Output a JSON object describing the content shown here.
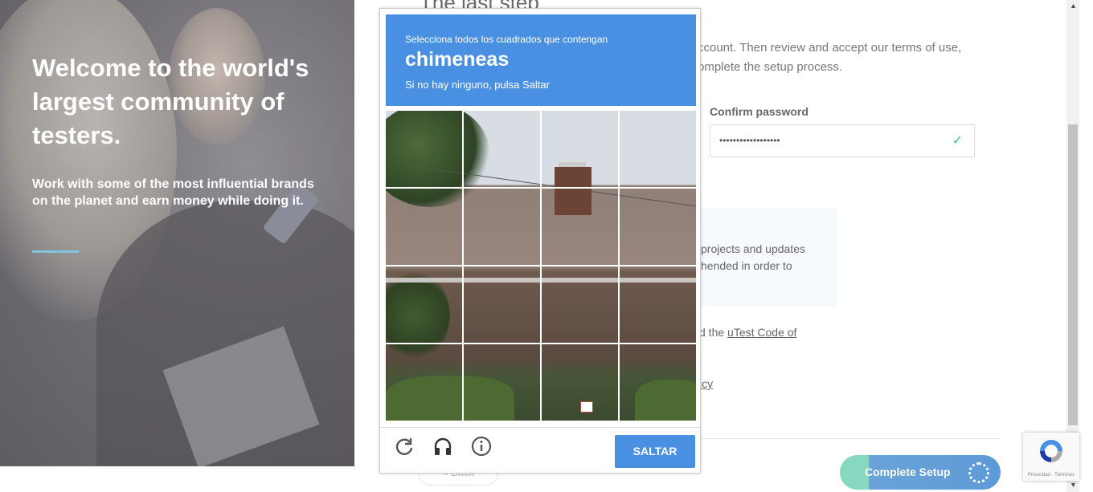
{
  "hero": {
    "title": "Welcome to the world's largest community of testers.",
    "subtitle": "Work with some of the most influential brands on the planet and earn money while doing it."
  },
  "form": {
    "title": "The last step",
    "description": "ccount. Then review and accept our terms of use, omplete the setup process.",
    "confirm_password_label": "Confirm password",
    "confirm_password_value": "••••••••••••••••••",
    "notify_text": "projects and updates hended in order to",
    "code_text_prefix": "d the ",
    "code_link": "uTest Code of",
    "policy_fragment": "icy",
    "back_label": "< Back",
    "complete_label": "Complete Setup"
  },
  "captcha": {
    "instruction": "Selecciona todos los cuadrados que contengan",
    "target": "chimeneas",
    "hint": "Si no hay ninguno, pulsa Saltar",
    "skip_label": "SALTAR",
    "grid_rows": 4,
    "grid_cols": 4
  },
  "recaptcha_badge": {
    "links": "Privacidad - Términos"
  },
  "colors": {
    "captcha_blue": "#4a90e2",
    "accent_teal": "#86d8c0",
    "check_green": "#39c59c"
  }
}
